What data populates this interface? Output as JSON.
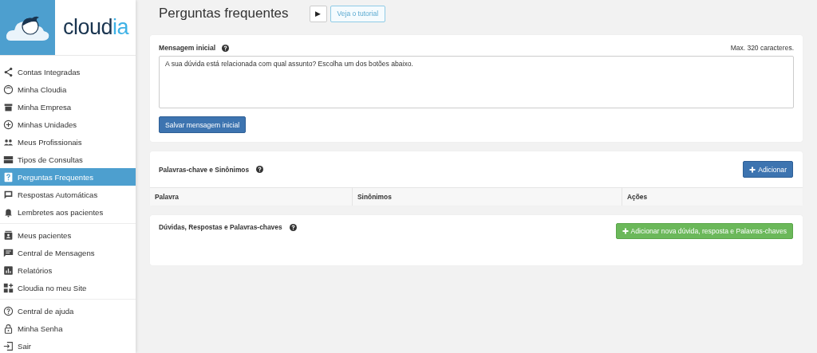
{
  "logo": {
    "text": "cloud",
    "accent": "ia"
  },
  "sidebar": {
    "groups": [
      [
        {
          "label": "Contas Integradas",
          "selected": false
        },
        {
          "label": "Minha Cloudia",
          "selected": false
        },
        {
          "label": "Minha Empresa",
          "selected": false
        },
        {
          "label": "Minhas Unidades",
          "selected": false
        },
        {
          "label": "Meus Profissionais",
          "selected": false
        },
        {
          "label": "Tipos de Consultas",
          "selected": false
        },
        {
          "label": "Perguntas Frequentes",
          "selected": true
        },
        {
          "label": "Respostas Automáticas",
          "selected": false
        },
        {
          "label": "Lembretes aos pacientes",
          "selected": false
        }
      ],
      [
        {
          "label": "Meus pacientes",
          "selected": false
        },
        {
          "label": "Central de Mensagens",
          "selected": false
        },
        {
          "label": "Relatórios",
          "selected": false
        },
        {
          "label": "Cloudia no meu Site",
          "selected": false
        }
      ],
      [
        {
          "label": "Central de ajuda",
          "selected": false
        },
        {
          "label": "Minha Senha",
          "selected": false
        },
        {
          "label": "Sair",
          "selected": false
        }
      ]
    ]
  },
  "header": {
    "title": "Perguntas frequentes",
    "play": "▶",
    "tutorial": "Veja o tutorial"
  },
  "initial_message": {
    "label": "Mensagem inicial",
    "limit": "Max. 320 caracteres.",
    "value": "A sua dúvida está relacionada com qual assunto? Escolha um dos botões abaixo.",
    "save": "Salvar mensagem inicial"
  },
  "keywords": {
    "title": "Palavras-chave e Sinônimos",
    "add": "Adicionar",
    "columns": [
      "Palavra",
      "Sinônimos",
      "Ações"
    ]
  },
  "faqs": {
    "title": "Dúvidas, Respostas e Palavras-chaves",
    "add": "Adicionar nova dúvida, resposta e Palavras-chaves"
  }
}
